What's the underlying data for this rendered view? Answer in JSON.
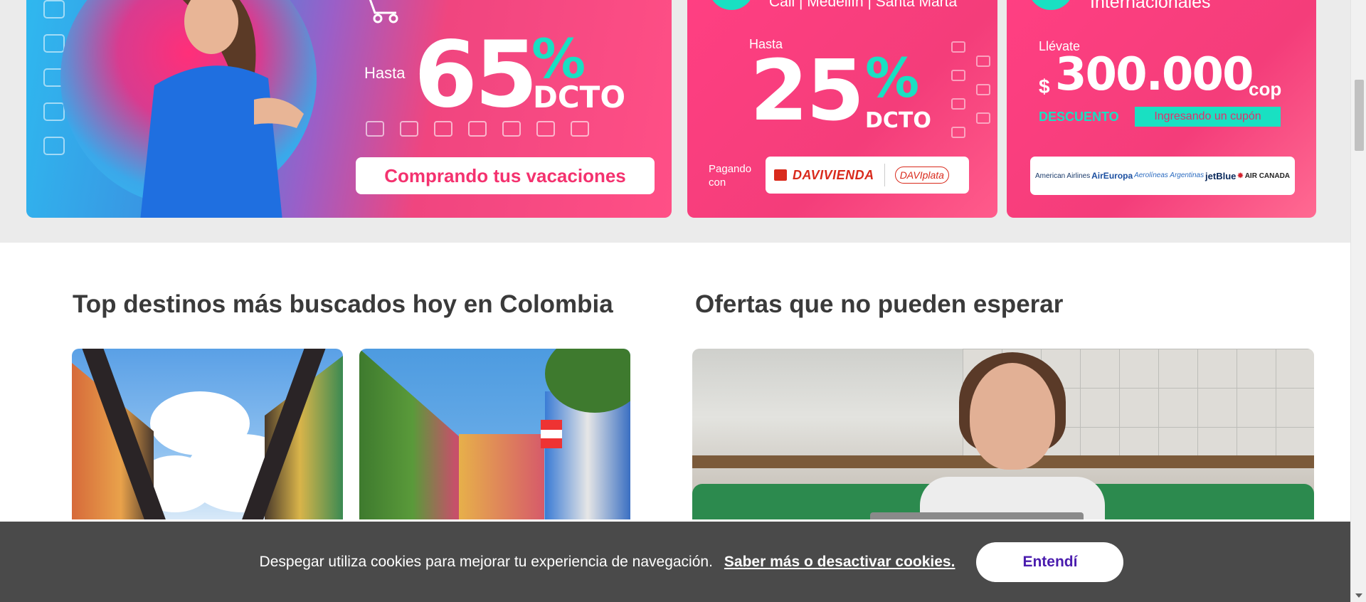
{
  "promos": {
    "main": {
      "hasta": "Hasta",
      "number": "65",
      "percent": "%",
      "dcto": "DCTO",
      "cta": "Comprando tus vacaciones"
    },
    "second": {
      "cities": "Cali | Medellín | Santa Marta",
      "hasta": "Hasta",
      "number": "25",
      "percent": "%",
      "dcto": "DCTO",
      "paying_with": "Pagando con",
      "bank": "DAVIVIENDA",
      "wallet_prefix": "DAVI",
      "wallet_suffix": "plata"
    },
    "third": {
      "heading": "Internacionales",
      "take": "Llévate",
      "currency": "$",
      "amount": "300.000",
      "unit": "cop",
      "discount": "DESCUENTO",
      "coupon": "Ingresando un cupón",
      "airlines": [
        "American Airlines",
        "AirEuropa",
        "Aerolíneas Argentinas",
        "jetBlue",
        "AIR CANADA"
      ]
    }
  },
  "sections": {
    "top_destinations": "Top destinos más buscados hoy en Colombia",
    "offers": "Ofertas que no pueden esperar"
  },
  "cookie": {
    "text": "Despegar utiliza cookies para mejorar tu experiencia de navegación.",
    "link": "Saber más o desactivar cookies.",
    "button": "Entendí"
  },
  "colors": {
    "brand_pink": "#f43d7a",
    "accent_teal": "#19e0c2",
    "button_purple": "#4a1cae"
  }
}
